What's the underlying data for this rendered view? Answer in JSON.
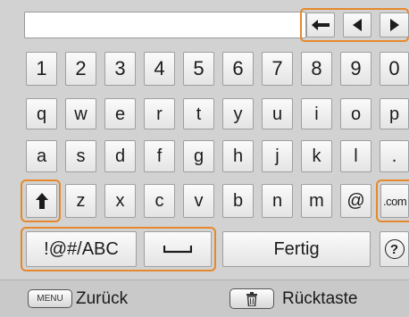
{
  "text_field": {
    "value": ""
  },
  "arrows": [
    "backspace-arrow-icon",
    "cursor-left-icon",
    "cursor-right-icon"
  ],
  "keyboard": {
    "row_digits": [
      "1",
      "2",
      "3",
      "4",
      "5",
      "6",
      "7",
      "8",
      "9",
      "0"
    ],
    "row_q": [
      "q",
      "w",
      "e",
      "r",
      "t",
      "y",
      "u",
      "i",
      "o",
      "p"
    ],
    "row_a": [
      "a",
      "s",
      "d",
      "f",
      "g",
      "h",
      "j",
      "k",
      "l",
      "."
    ],
    "row_z": [
      "z",
      "x",
      "c",
      "v",
      "b",
      "n",
      "m",
      "@"
    ],
    "dotcom": ".com",
    "mode_label": "!@#/ABC",
    "space_symbol": "⎵",
    "done_label": "Fertig",
    "help_symbol": "?"
  },
  "guide": {
    "menu_badge": "MENU",
    "back_label": "Zurück",
    "delete_label": "Rücktaste"
  },
  "colors": {
    "highlight": "#e6892c",
    "background": "#d2d2d2",
    "key": "#f2f2f2"
  }
}
